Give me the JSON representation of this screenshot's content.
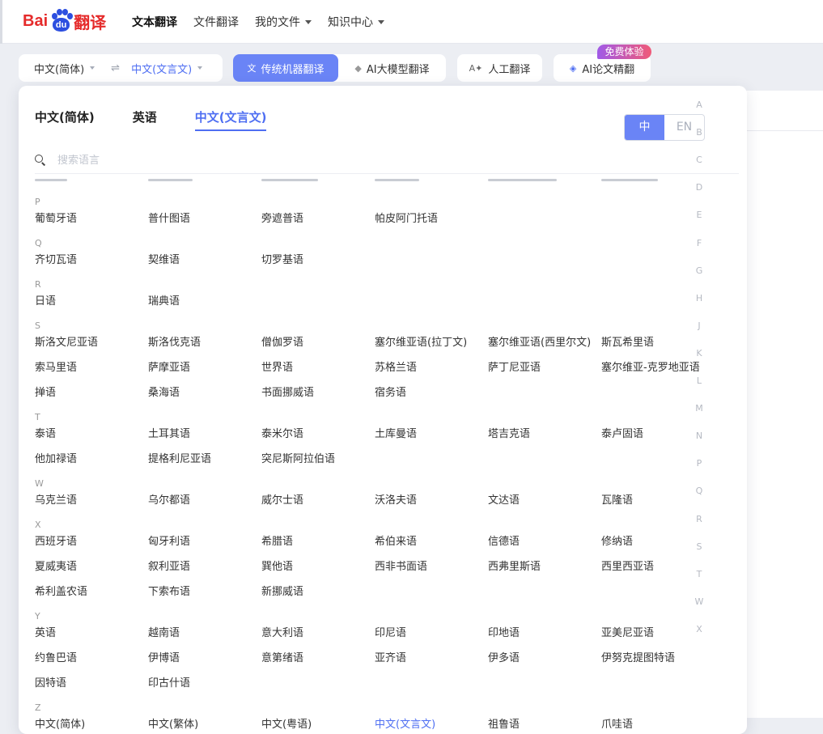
{
  "header": {
    "logo": {
      "bai": "Bai",
      "du": "du",
      "fanyi": "翻译"
    },
    "nav": [
      {
        "label": "文本翻译",
        "active": true,
        "dropdown": false
      },
      {
        "label": "文件翻译",
        "active": false,
        "dropdown": false
      },
      {
        "label": "我的文件",
        "active": false,
        "dropdown": true
      },
      {
        "label": "知识中心",
        "active": false,
        "dropdown": true
      }
    ]
  },
  "toolbar": {
    "source_lang": "中文(简体)",
    "swap_symbol": "⇌",
    "target_lang": "中文(文言文)",
    "mode_machine": "传统机器翻译",
    "mode_ai_model": "AI大模型翻译",
    "human": "人工翻译",
    "ai_paper": "AI论文精翻",
    "badge": "免费体验"
  },
  "dropdown": {
    "tabs": [
      {
        "label": "中文(简体)",
        "active": false
      },
      {
        "label": "英语",
        "active": false
      },
      {
        "label": "中文(文言文)",
        "active": true
      }
    ],
    "toggle": {
      "zh": "中",
      "en": "EN",
      "selected": "zh"
    },
    "search_placeholder": "搜索语言",
    "groups": [
      {
        "letter": "P",
        "rows": [
          [
            "葡萄牙语",
            "普什图语",
            "旁遮普语",
            "帕皮阿门托语"
          ]
        ]
      },
      {
        "letter": "Q",
        "rows": [
          [
            "齐切瓦语",
            "契维语",
            "切罗基语"
          ]
        ]
      },
      {
        "letter": "R",
        "rows": [
          [
            "日语",
            "瑞典语"
          ]
        ]
      },
      {
        "letter": "S",
        "rows": [
          [
            "斯洛文尼亚语",
            "斯洛伐克语",
            "僧伽罗语",
            "塞尔维亚语(拉丁文)",
            "塞尔维亚语(西里尔文)",
            "斯瓦希里语"
          ],
          [
            "索马里语",
            "萨摩亚语",
            "世界语",
            "苏格兰语",
            "萨丁尼亚语",
            "塞尔维亚-克罗地亚语"
          ],
          [
            "掸语",
            "桑海语",
            "书面挪威语",
            "宿务语"
          ]
        ]
      },
      {
        "letter": "T",
        "rows": [
          [
            "泰语",
            "土耳其语",
            "泰米尔语",
            "土库曼语",
            "塔吉克语",
            "泰卢固语"
          ],
          [
            "他加禄语",
            "提格利尼亚语",
            "突尼斯阿拉伯语"
          ]
        ]
      },
      {
        "letter": "W",
        "rows": [
          [
            "乌克兰语",
            "乌尔都语",
            "威尔士语",
            "沃洛夫语",
            "文达语",
            "瓦隆语"
          ]
        ]
      },
      {
        "letter": "X",
        "rows": [
          [
            "西班牙语",
            "匈牙利语",
            "希腊语",
            "希伯来语",
            "信德语",
            "修纳语"
          ],
          [
            "夏威夷语",
            "叙利亚语",
            "巽他语",
            "西非书面语",
            "西弗里斯语",
            "西里西亚语"
          ],
          [
            "希利盖农语",
            "下索布语",
            "新挪威语"
          ]
        ]
      },
      {
        "letter": "Y",
        "rows": [
          [
            "英语",
            "越南语",
            "意大利语",
            "印尼语",
            "印地语",
            "亚美尼亚语"
          ],
          [
            "约鲁巴语",
            "伊博语",
            "意第绪语",
            "亚齐语",
            "伊多语",
            "伊努克提图特语"
          ],
          [
            "因特语",
            "印古什语"
          ]
        ]
      },
      {
        "letter": "Z",
        "rows": [
          [
            "中文(简体)",
            "中文(繁体)",
            "中文(粤语)",
            "中文(文言文)",
            "祖鲁语",
            "爪哇语"
          ]
        ]
      }
    ],
    "selected_language": "中文(文言文)",
    "index_letters": [
      "A",
      "B",
      "C",
      "D",
      "E",
      "F",
      "G",
      "H",
      "J",
      "K",
      "L",
      "M",
      "N",
      "P",
      "Q",
      "R",
      "S",
      "T",
      "W",
      "X"
    ]
  },
  "colors": {
    "accent": "#4e6ef2",
    "active_bg": "#6a84f6",
    "brand_red": "#e52b2b",
    "brand_blue": "#2d4fe0"
  }
}
